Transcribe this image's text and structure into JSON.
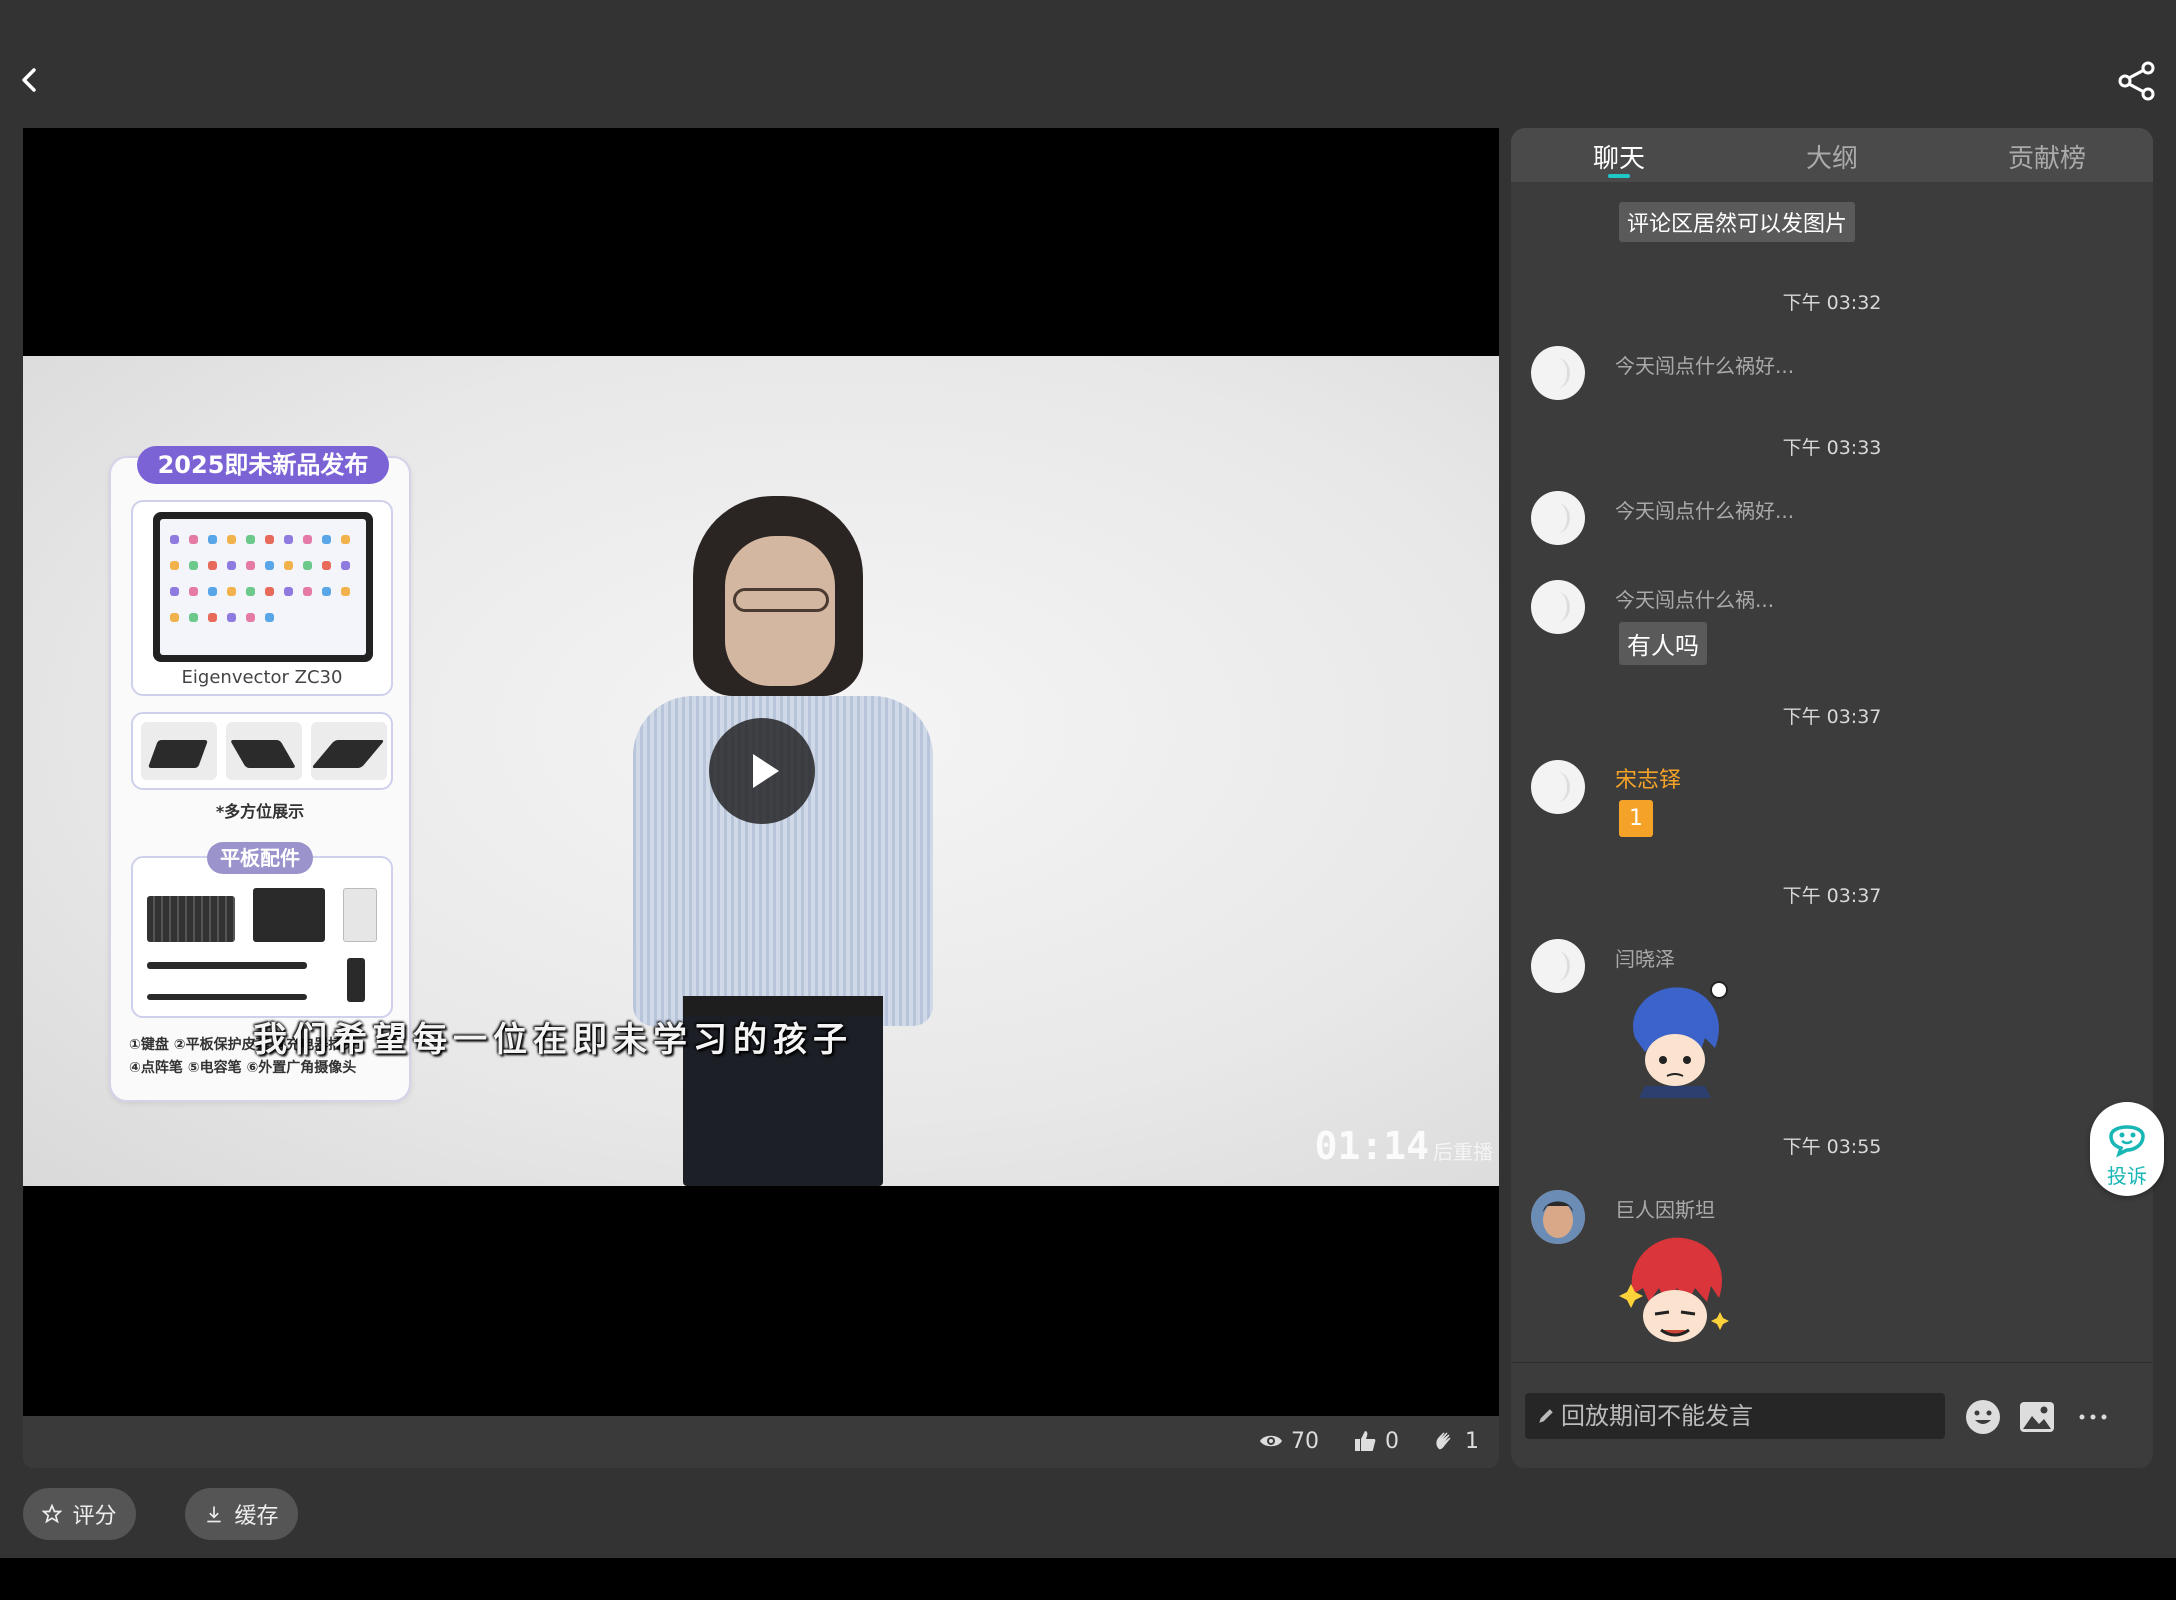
{
  "colors": {
    "background": "#333333",
    "accent": "#1ec8c8",
    "highlight": "#f4a328",
    "panel": "#3c3c3c"
  },
  "video": {
    "promo": {
      "title": "2025即未新品发布",
      "tablet_brand": "Eigenvector ZC30",
      "multi_view": "*多方位展示",
      "accessories_label": "平板配件",
      "accessories_line1": "①键盘 ②平板保护皮套 ③充电器插头",
      "accessories_line2": "④点阵笔 ⑤电容笔 ⑥外置广角摄像头"
    },
    "subtitle": "我们希望每一位在即未学习的孩子",
    "timer": "01:14",
    "timer_suffix": "后重播"
  },
  "stats": {
    "views": "70",
    "likes": "0",
    "claps": "1"
  },
  "actions": {
    "rate": "评分",
    "cache": "缓存"
  },
  "panel": {
    "tabs": [
      "聊天",
      "大纲",
      "贡献榜"
    ],
    "top_bubble": "评论区居然可以发图片",
    "messages": [
      {
        "time": "下午 03:32",
        "name": "今天闯点什么祸好..."
      },
      {
        "time": "下午 03:33",
        "name": "今天闯点什么祸好..."
      },
      {
        "name": "今天闯点什么祸...",
        "text": "有人吗"
      },
      {
        "time": "下午 03:37",
        "name": "宋志铎",
        "text": "1"
      },
      {
        "time": "下午 03:37",
        "name": "闫晓泽",
        "sticker": "blue-hair-sticker"
      },
      {
        "time": "下午 03:55",
        "name": "巨人因斯坦",
        "sticker": "red-hair-sticker"
      }
    ],
    "input_placeholder": "回放期间不能发言",
    "report": "投诉"
  }
}
